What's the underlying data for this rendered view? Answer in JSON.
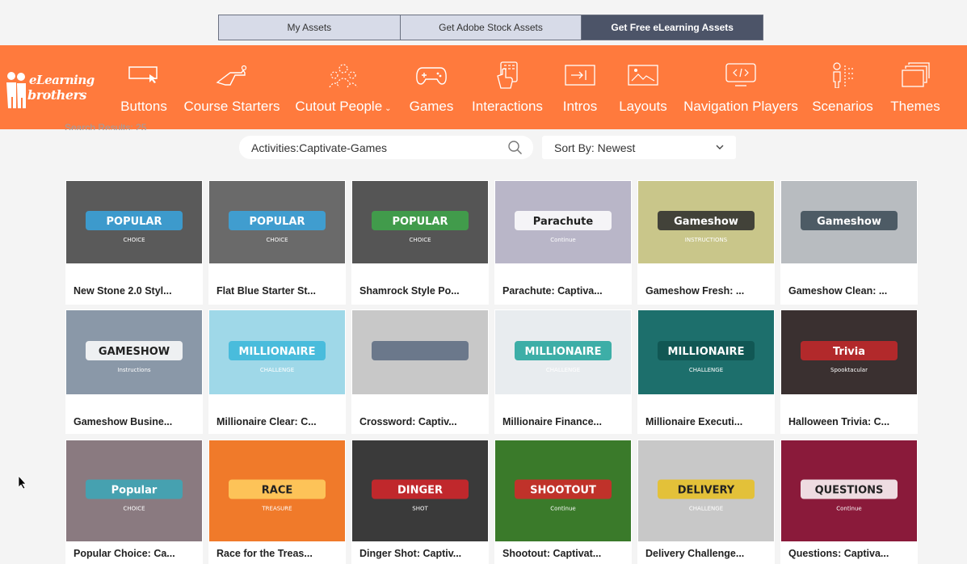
{
  "tabs": [
    {
      "label": "My Assets"
    },
    {
      "label": "Get Adobe Stock Assets"
    },
    {
      "label": "Get Free eLearning Assets"
    }
  ],
  "logo": {
    "line1": "eLearning",
    "line2": "brothers"
  },
  "nav": [
    {
      "label": "Buttons",
      "icon": "button-cursor-icon"
    },
    {
      "label": "Course Starters",
      "icon": "starter-pistol-icon"
    },
    {
      "label": "Cutout People",
      "icon": "people-icon",
      "has_dropdown": true
    },
    {
      "label": "Games",
      "icon": "gamepad-icon"
    },
    {
      "label": "Interactions",
      "icon": "touch-icon"
    },
    {
      "label": "Intros",
      "icon": "intro-icon"
    },
    {
      "label": "Layouts",
      "icon": "layout-image-icon"
    },
    {
      "label": "Navigation Players",
      "icon": "player-code-icon"
    },
    {
      "label": "Scenarios",
      "icon": "scenario-icon"
    },
    {
      "label": "Themes",
      "icon": "stack-icon"
    }
  ],
  "breadcrumb": "Search Results: 25",
  "search": {
    "value": "Activities:Captivate-Games",
    "placeholder": "Search"
  },
  "sort": {
    "label": "Sort By: Newest"
  },
  "cards": [
    {
      "title": "New Stone 2.0 Styl...",
      "thumb_text": "POPULAR",
      "thumb_sub": "CHOICE",
      "bg": "#5a5a5a",
      "accent": "#38a6e0"
    },
    {
      "title": "Flat Blue Starter St...",
      "thumb_text": "POPULAR",
      "thumb_sub": "CHOICE",
      "bg": "#6a6a6a",
      "accent": "#38a6e0"
    },
    {
      "title": "Shamrock Style Po...",
      "thumb_text": "POPULAR",
      "thumb_sub": "CHOICE",
      "bg": "#555",
      "accent": "#3ea84a"
    },
    {
      "title": "Parachute: Captiva...",
      "thumb_text": "Parachute",
      "thumb_sub": "Continue",
      "bg": "#b9b6c8",
      "accent": "#fff"
    },
    {
      "title": "Gameshow Fresh: ...",
      "thumb_text": "Gameshow",
      "thumb_sub": "INSTRUCTIONS",
      "bg": "#c9c68a",
      "accent": "#2a2a2a"
    },
    {
      "title": "Gameshow Clean: ...",
      "thumb_text": "Gameshow",
      "thumb_sub": "",
      "bg": "#b8bcc0",
      "accent": "#3a4a55"
    },
    {
      "title": "Gameshow Busine...",
      "thumb_text": "GAMESHOW",
      "thumb_sub": "Instructions",
      "bg": "#8a98a8",
      "accent": "#fff"
    },
    {
      "title": "Millionaire Clear: C...",
      "thumb_text": "MILLIONAIRE",
      "thumb_sub": "CHALLENGE",
      "bg": "#9fd8e8",
      "accent": "#3ab7d9"
    },
    {
      "title": "Crossword: Captiv...",
      "thumb_text": "",
      "thumb_sub": "",
      "bg": "#c8c8c8",
      "accent": "#5a6a80"
    },
    {
      "title": "Millionaire Finance...",
      "thumb_text": "MILLIONAIRE",
      "thumb_sub": "CHALLENGE",
      "bg": "#e8ecef",
      "accent": "#1fa39a"
    },
    {
      "title": "Millionaire Executi...",
      "thumb_text": "MILLIONAIRE",
      "thumb_sub": "CHALLENGE",
      "bg": "#1d6f6c",
      "accent": "#0f5350"
    },
    {
      "title": "Halloween Trivia: C...",
      "thumb_text": "Trivia",
      "thumb_sub": "Spooktacular",
      "bg": "#3a3030",
      "accent": "#c8282a"
    },
    {
      "title": "Popular Choice: Ca...",
      "thumb_text": "Popular",
      "thumb_sub": "CHOICE",
      "bg": "#8a7a80",
      "accent": "#3aa8b8"
    },
    {
      "title": "Race for the Treas...",
      "thumb_text": "RACE",
      "thumb_sub": "TREASURE",
      "bg": "#f07a2a",
      "accent": "#ffd060"
    },
    {
      "title": "Dinger Shot: Captiv...",
      "thumb_text": "DINGER",
      "thumb_sub": "SHOT",
      "bg": "#3a3a3a",
      "accent": "#d8262a"
    },
    {
      "title": "Shootout: Captivat...",
      "thumb_text": "SHOOTOUT",
      "thumb_sub": "Continue",
      "bg": "#3a7a2a",
      "accent": "#d8262a"
    },
    {
      "title": "Delivery Challenge...",
      "thumb_text": "DELIVERY",
      "thumb_sub": "CHALLENGE",
      "bg": "#c8c8c8",
      "accent": "#e8c020"
    },
    {
      "title": "Questions: Captiva...",
      "thumb_text": "QUESTIONS",
      "thumb_sub": "Continue",
      "bg": "#8a1a3a",
      "accent": "#fff"
    }
  ]
}
